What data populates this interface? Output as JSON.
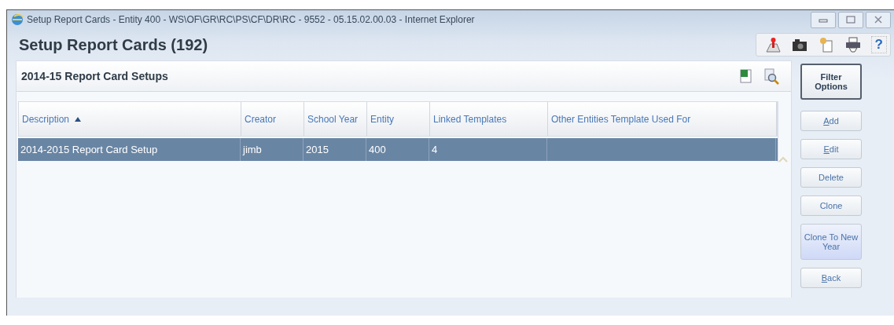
{
  "window": {
    "title": "Setup Report Cards - Entity 400 - WS\\OF\\GR\\RC\\PS\\CF\\DR\\RC - 9552 - 05.15.02.00.03 - Internet Explorer"
  },
  "page_title": "Setup Report Cards (192)",
  "toolbar": {
    "help": "?"
  },
  "panel": {
    "title": "2014-15 Report Card Setups"
  },
  "table": {
    "columns": [
      {
        "label": "Description",
        "sorted": true
      },
      {
        "label": "Creator",
        "sorted": false
      },
      {
        "label": "School Year",
        "sorted": false
      },
      {
        "label": "Entity",
        "sorted": false
      },
      {
        "label": "Linked Templates",
        "sorted": false
      },
      {
        "label": "Other Entities Template Used For",
        "sorted": false
      }
    ],
    "rows": [
      {
        "selected": true,
        "cells": [
          "2014-2015 Report Card Setup",
          "jimb",
          "2015",
          "400",
          "4",
          ""
        ]
      }
    ]
  },
  "buttons": [
    {
      "label": "Filter Options",
      "access_key": false,
      "kind": "primary"
    },
    {
      "label": "Add",
      "access_key": true,
      "kind": "normal"
    },
    {
      "label": "Edit",
      "access_key": true,
      "kind": "normal"
    },
    {
      "label": "Delete",
      "access_key": false,
      "kind": "normal"
    },
    {
      "label": "Clone",
      "access_key": false,
      "kind": "normal"
    },
    {
      "label": "Clone To New Year",
      "access_key": false,
      "kind": "highlight"
    },
    {
      "label": "Back",
      "access_key": true,
      "kind": "normal"
    }
  ]
}
